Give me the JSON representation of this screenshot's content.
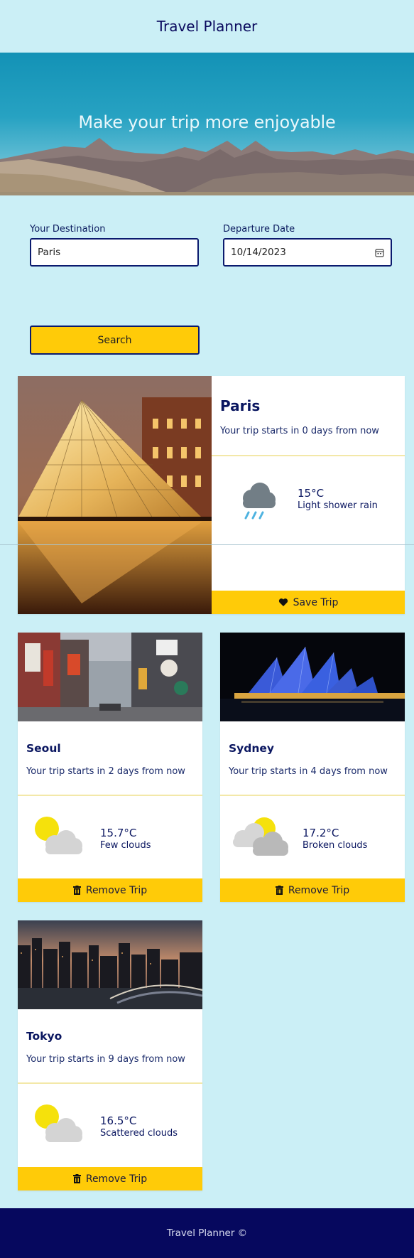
{
  "header": {
    "title": "Travel Planner"
  },
  "hero": {
    "title": "Make your trip more enjoyable"
  },
  "form": {
    "destination_label": "Your Destination",
    "destination_value": "Paris",
    "date_label": "Departure Date",
    "date_value": "10/14/2023",
    "search_label": "Search"
  },
  "featured": {
    "city": "Paris",
    "days_text": "Your trip starts in 0 days from now",
    "temp": "15°C",
    "condition": "Light shower rain",
    "weather_icon": "rain-cloud-icon",
    "button_label": "Save Trip",
    "button_icon": "heart-icon"
  },
  "trips": [
    {
      "city": "Seoul",
      "days_text": "Your trip starts in 2 days from now",
      "temp": "15.7°C",
      "condition": "Few clouds",
      "weather_icon": "sun-cloud-icon",
      "button_label": "Remove Trip",
      "button_icon": "trash-icon"
    },
    {
      "city": "Sydney",
      "days_text": "Your trip starts in 4 days from now",
      "temp": "17.2°C",
      "condition": "Broken clouds",
      "weather_icon": "broken-clouds-icon",
      "button_label": "Remove Trip",
      "button_icon": "trash-icon"
    },
    {
      "city": "Tokyo",
      "days_text": "Your trip starts in 9 days from now",
      "temp": "16.5°C",
      "condition": "Scattered clouds",
      "weather_icon": "sun-cloud-icon",
      "button_label": "Remove Trip",
      "button_icon": "trash-icon"
    }
  ],
  "footer": {
    "text": "Travel Planner ©"
  },
  "colors": {
    "background": "#cbeff6",
    "accent": "#ffcb08",
    "navy": "#06085e",
    "text": "#0a1660"
  }
}
